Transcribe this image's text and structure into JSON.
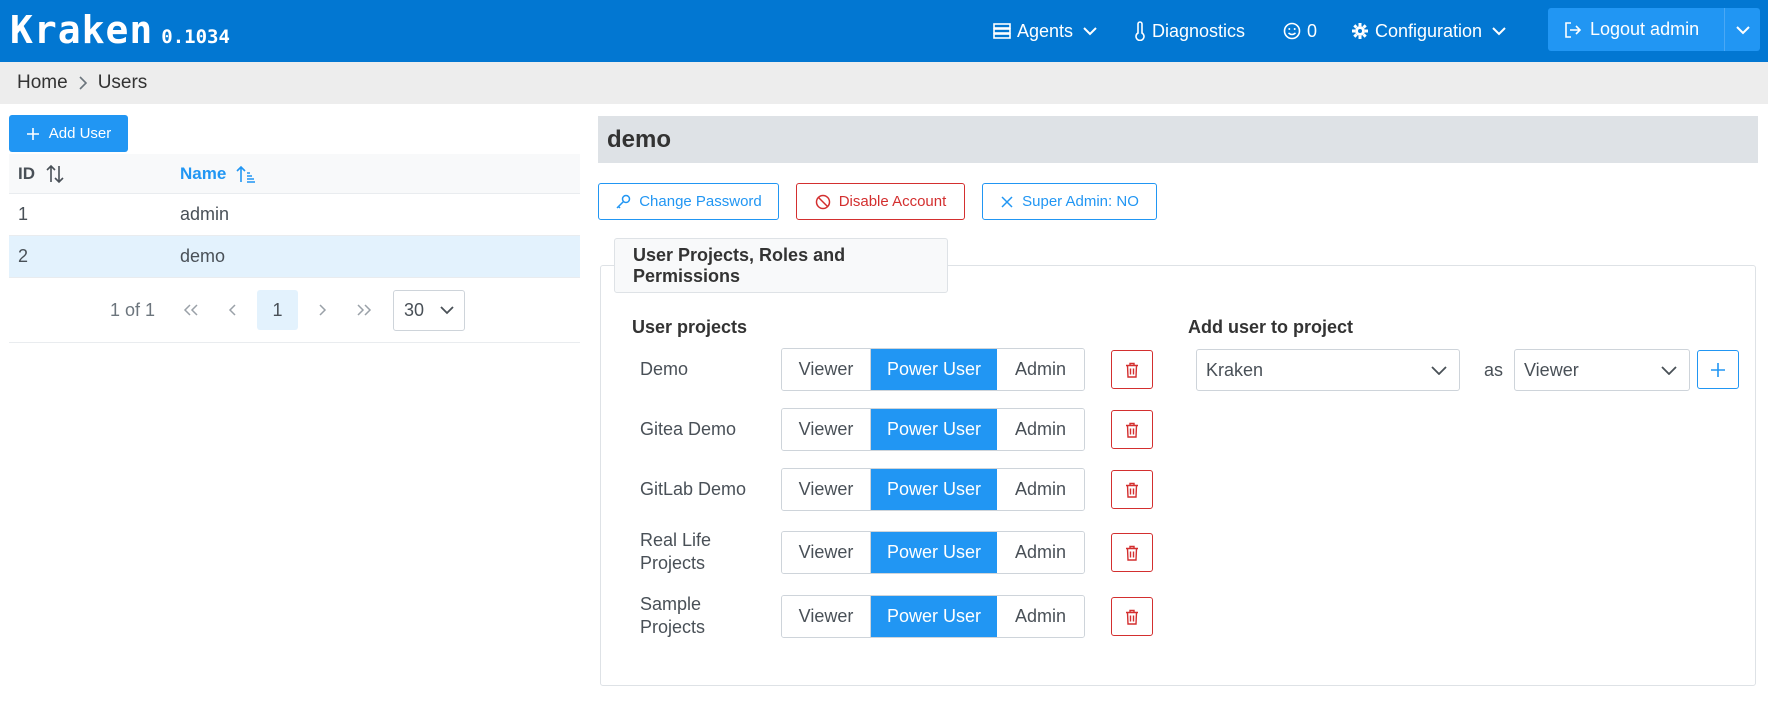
{
  "app": {
    "name": "Kraken",
    "version": "0.1034"
  },
  "nav": {
    "agents": "Agents",
    "diagnostics": "Diagnostics",
    "errors_count": "0",
    "configuration": "Configuration",
    "logout": "Logout admin"
  },
  "breadcrumb": {
    "home": "Home",
    "current": "Users"
  },
  "users_panel": {
    "add_user_label": "Add User",
    "columns": {
      "id": "ID",
      "name": "Name"
    },
    "rows": [
      {
        "id": "1",
        "name": "admin"
      },
      {
        "id": "2",
        "name": "demo"
      }
    ],
    "paginator": {
      "report": "1 of 1",
      "current_page": "1",
      "page_size": "30"
    }
  },
  "user_detail": {
    "username": "demo",
    "change_password_label": "Change Password",
    "disable_account_label": "Disable Account",
    "super_admin_label": "Super Admin: NO",
    "section_title": "User Projects, Roles and Permissions",
    "user_projects_title": "User projects",
    "add_to_project_title": "Add user to project",
    "roles": {
      "viewer": "Viewer",
      "power_user": "Power User",
      "admin": "Admin"
    },
    "projects": [
      {
        "name": "Demo",
        "role": "Power User"
      },
      {
        "name": "Gitea Demo",
        "role": "Power User"
      },
      {
        "name": "GitLab Demo",
        "role": "Power User"
      },
      {
        "name": "Real Life Projects",
        "role": "Power User"
      },
      {
        "name": "Sample Projects",
        "role": "Power User"
      }
    ],
    "add_project_select": "Kraken",
    "as_label": "as",
    "add_role_select": "Viewer"
  },
  "colors": {
    "topbar": "#0277d2",
    "primary": "#2196f3",
    "danger": "#d32f2f"
  }
}
